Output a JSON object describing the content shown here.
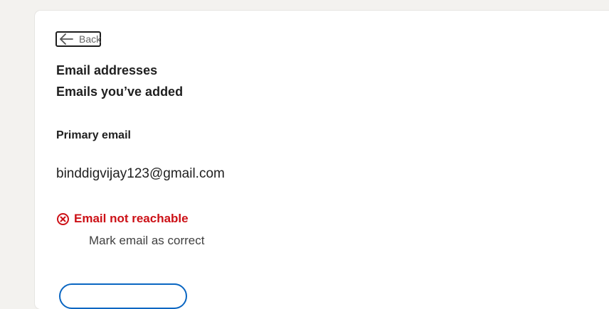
{
  "nav": {
    "back_label": "Back"
  },
  "header": {
    "title": "Email addresses",
    "subtitle": "Emails you’ve added"
  },
  "primary": {
    "label": "Primary email",
    "email": "binddigvijay123@gmail.com",
    "status_text": "Email not reachable",
    "status_color": "#cc1016",
    "mark_correct_label": "Mark email as correct"
  },
  "colors": {
    "page_bg": "#f3f2ef",
    "card_bg": "#ffffff",
    "accent": "#0a66c2"
  },
  "icons": {
    "back": "arrow-left-icon",
    "status": "error-circle-x-icon"
  }
}
